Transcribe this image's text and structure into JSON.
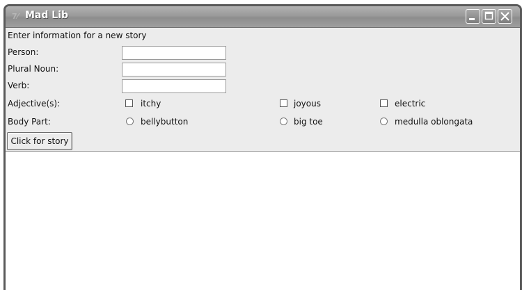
{
  "window": {
    "title": "Mad Lib",
    "app_icon_glyph": "7⁄",
    "controls": [
      "minimize-icon",
      "maximize-icon",
      "close-icon"
    ]
  },
  "form": {
    "heading": "Enter information for a new story",
    "person_label": "Person:",
    "person_value": "",
    "plural_noun_label": "Plural Noun:",
    "plural_noun_value": "",
    "verb_label": "Verb:",
    "verb_value": "",
    "adjectives_label": "Adjective(s):",
    "adjectives": [
      {
        "label": "itchy",
        "checked": false
      },
      {
        "label": "joyous",
        "checked": false
      },
      {
        "label": "electric",
        "checked": false
      }
    ],
    "body_part_label": "Body Part:",
    "body_parts": [
      {
        "label": "bellybutton",
        "selected": false
      },
      {
        "label": "big toe",
        "selected": false
      },
      {
        "label": "medulla oblongata",
        "selected": false
      }
    ],
    "submit_label": "Click for story"
  },
  "story": {
    "text": ""
  },
  "colors": {
    "titlebar": "#9a9a9a",
    "window_bg": "#ececec",
    "frame": "#5a5a5a"
  }
}
